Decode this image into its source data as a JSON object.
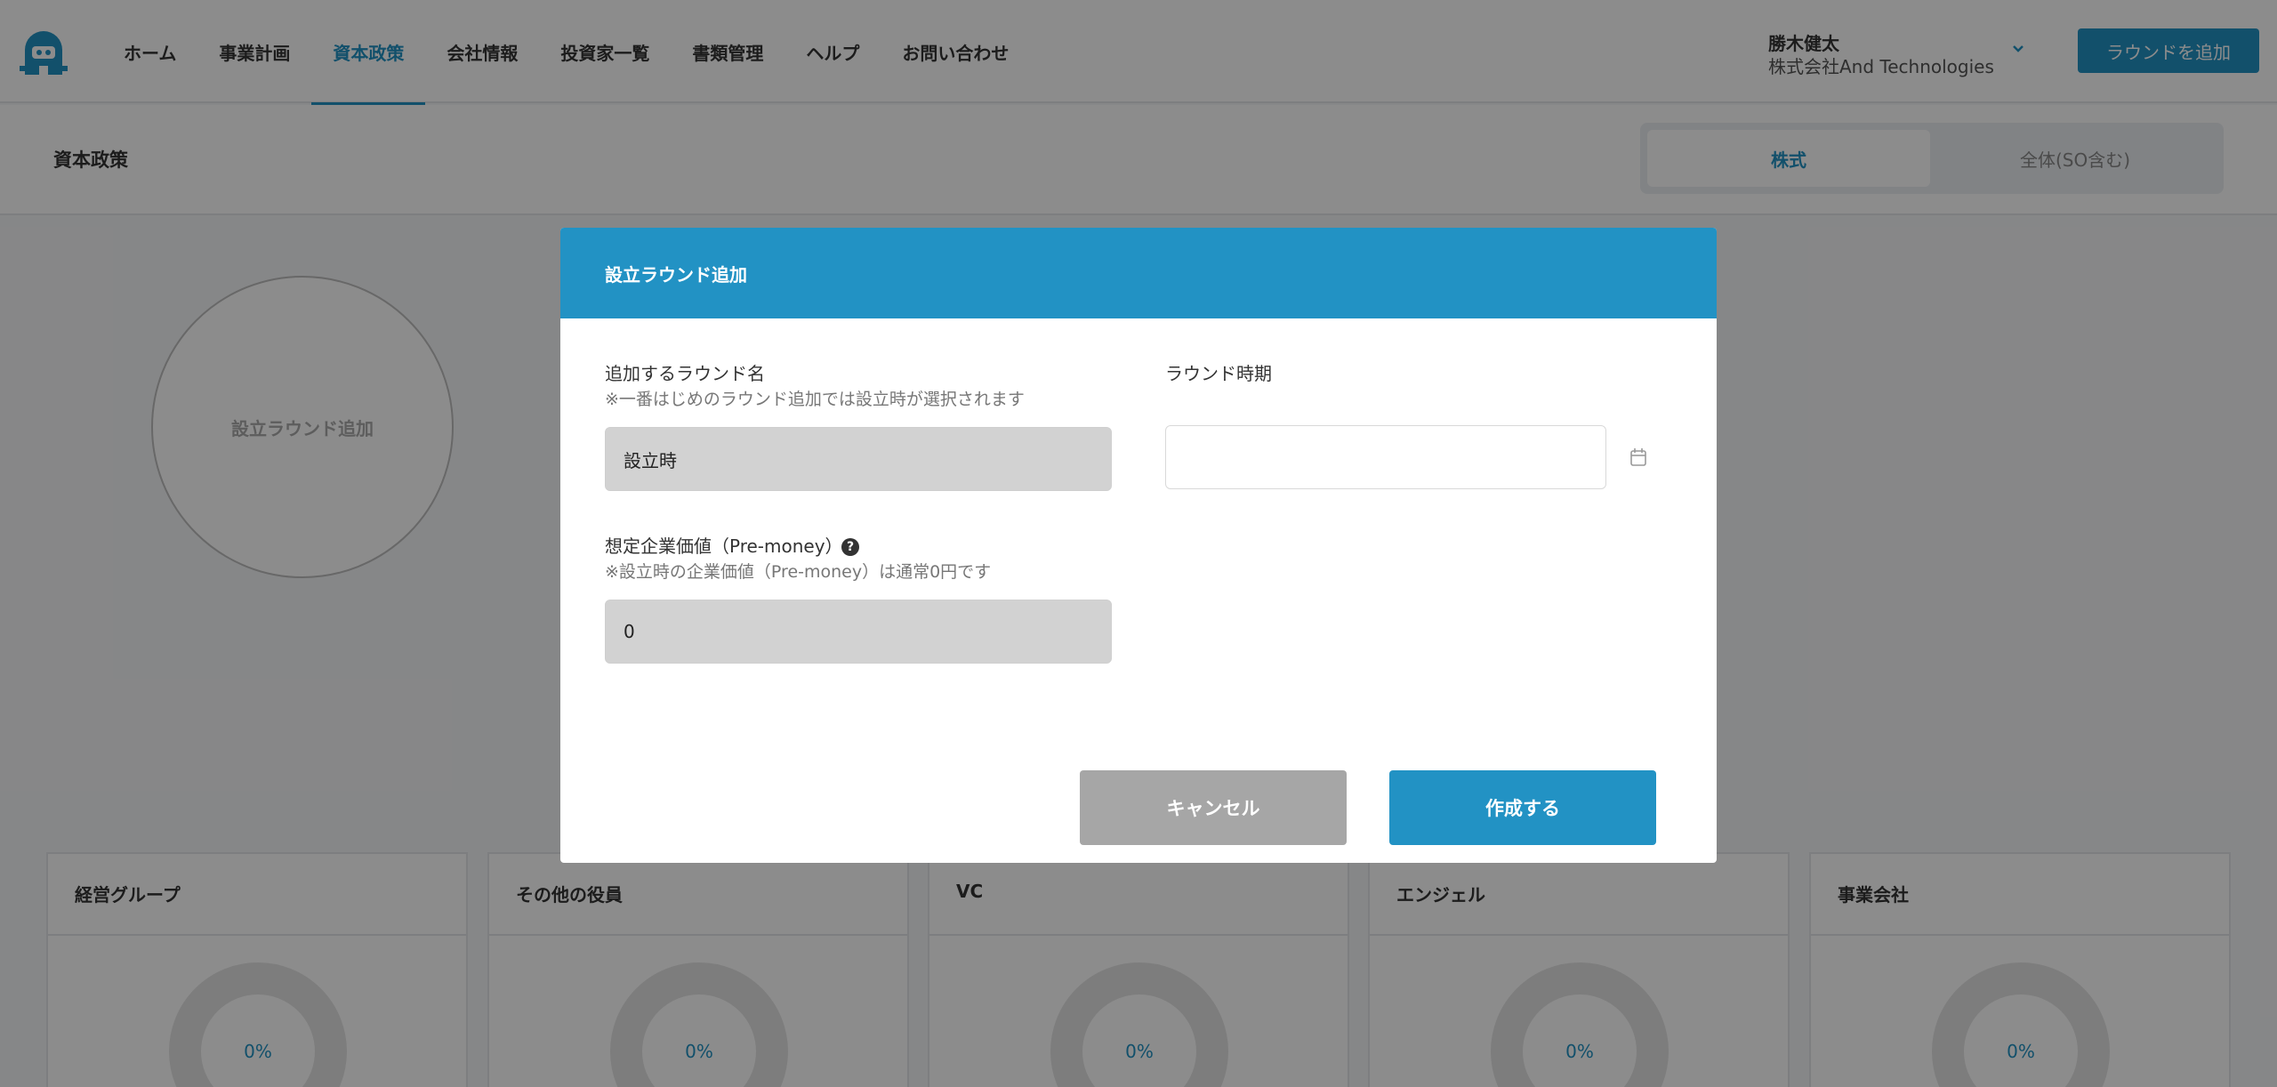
{
  "header": {
    "nav": [
      "ホーム",
      "事業計画",
      "資本政策",
      "会社情報",
      "投資家一覧",
      "書類管理",
      "ヘルプ",
      "お問い合わせ"
    ],
    "active_nav": "資本政策",
    "user_name": "勝木健太",
    "user_company": "株式会社And Technologies",
    "add_round_label": "ラウンドを追加"
  },
  "subheader": {
    "title": "資本政策",
    "toggle_on": "株式",
    "toggle_off": "全体(SO含む)"
  },
  "body": {
    "round_circle_label": "設立ラウンド追加",
    "cards": [
      {
        "title": "経営グループ",
        "value": "0%"
      },
      {
        "title": "その他の役員",
        "value": "0%"
      },
      {
        "title": "VC",
        "value": "0%"
      },
      {
        "title": "エンジェル",
        "value": "0%"
      },
      {
        "title": "事業会社",
        "value": "0%"
      }
    ]
  },
  "modal": {
    "title": "設立ラウンド追加",
    "round_name_label": "追加するラウンド名",
    "round_name_note": "※一番はじめのラウンド追加では設立時が選択されます",
    "round_name_value": "設立時",
    "round_date_label": "ラウンド時期",
    "round_date_value": "",
    "valuation_label": "想定企業価値（Pre-money）",
    "valuation_note": "※設立時の企業価値（Pre-money）は通常0円です",
    "valuation_value": "0",
    "cancel_label": "キャンセル",
    "create_label": "作成する"
  },
  "colors": {
    "accent": "#2292c4",
    "cancel": "#a6a6a6",
    "readonly_field": "#d2d2d2"
  },
  "icons": [
    "logo-icon",
    "chevron-down-icon",
    "help-icon",
    "calendar-icon"
  ]
}
